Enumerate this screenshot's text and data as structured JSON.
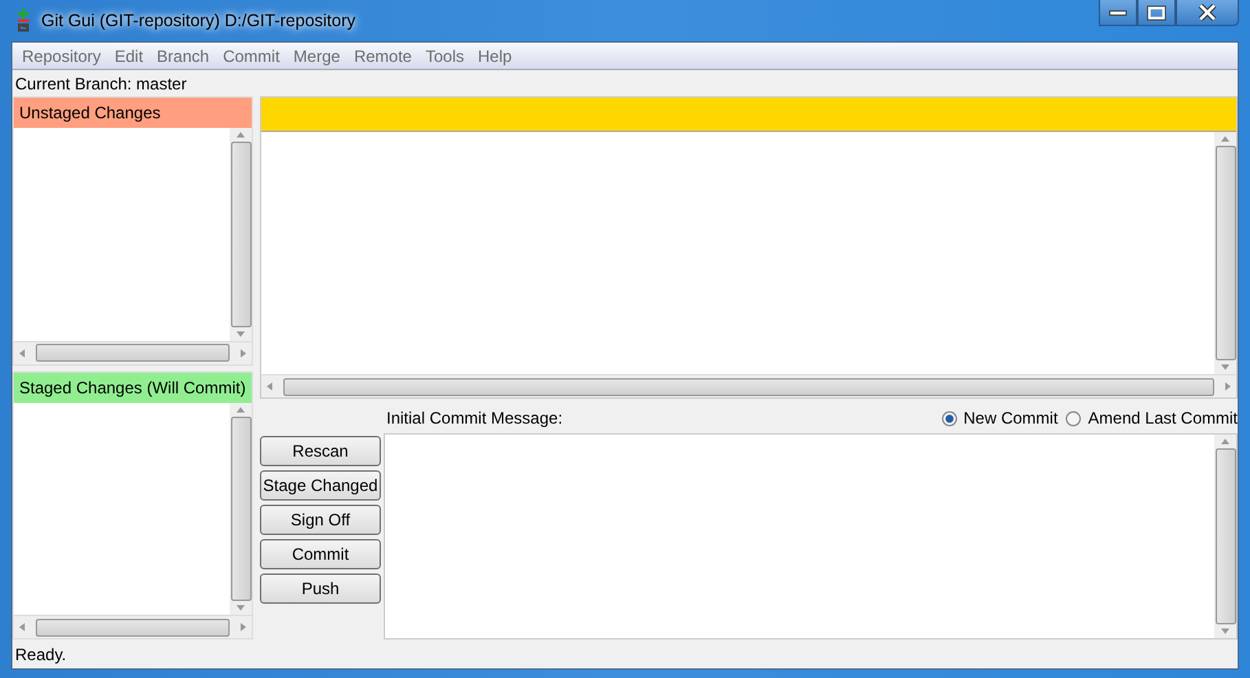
{
  "window": {
    "title": "Git Gui (GIT-repository) D:/GIT-repository"
  },
  "menu": [
    "Repository",
    "Edit",
    "Branch",
    "Commit",
    "Merge",
    "Remote",
    "Tools",
    "Help"
  ],
  "branch_label": "Current Branch: master",
  "unstaged": {
    "title": "Unstaged Changes"
  },
  "staged": {
    "title": "Staged Changes (Will Commit)"
  },
  "commit": {
    "label": "Initial Commit Message:",
    "options": [
      {
        "label": "New Commit",
        "selected": true
      },
      {
        "label": "Amend Last Commit",
        "selected": false
      }
    ]
  },
  "buttons": [
    "Rescan",
    "Stage Changed",
    "Sign Off",
    "Commit",
    "Push"
  ],
  "status_bar": "Ready."
}
